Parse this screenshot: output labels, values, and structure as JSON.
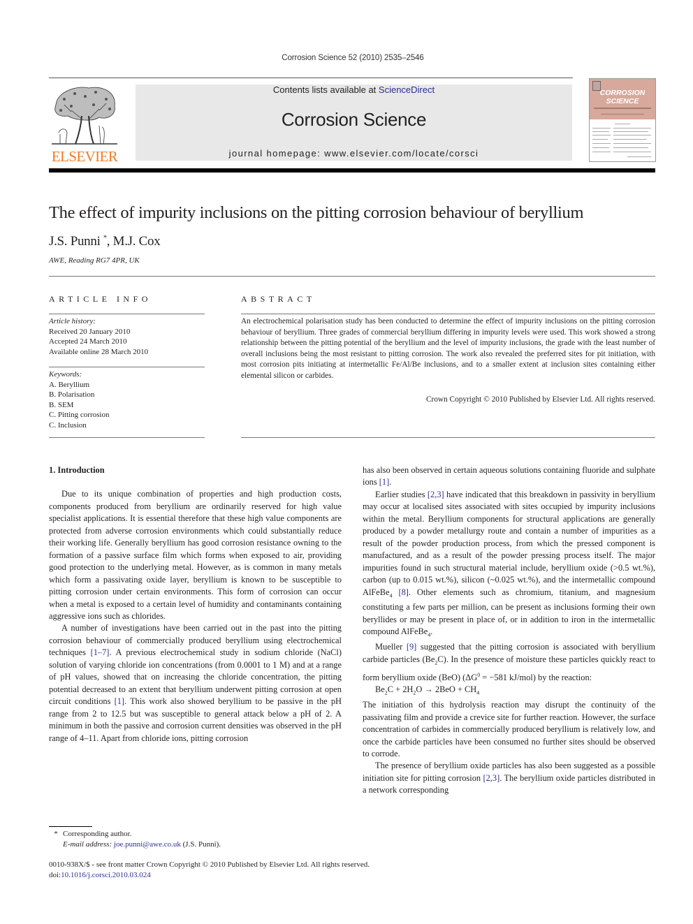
{
  "journal_ref": "Corrosion Science 52 (2010) 2535–2546",
  "masthead": {
    "contents_prefix": "Contents lists available at ",
    "contents_link": "ScienceDirect",
    "journal_name": "Corrosion Science",
    "homepage_prefix": "journal homepage: ",
    "homepage_url": "www.elsevier.com/locate/corsci",
    "publisher_logo_text": "ELSEVIER",
    "cover_title_line1": "CORROSION",
    "cover_title_line2": "SCIENCE"
  },
  "colors": {
    "elsevier_orange": "#f47a20",
    "link_blue": "#2b2f8e",
    "masthead_gray": "#e8e8e8",
    "cover_pink": "#d7a89c"
  },
  "article": {
    "title": "The effect of impurity inclusions on the pitting corrosion behaviour of beryllium",
    "authors": [
      {
        "name": "J.S. Punni",
        "mark": "*"
      },
      {
        "name": "M.J. Cox",
        "mark": ""
      }
    ],
    "author_separator": ", ",
    "affiliation": "AWE, Reading RG7 4PR, UK"
  },
  "article_info": {
    "heading": "ARTICLE INFO",
    "history_label": "Article history:",
    "history": [
      "Received 20 January 2010",
      "Accepted 24 March 2010",
      "Available online 28 March 2010"
    ],
    "keywords_label": "Keywords:",
    "keywords": [
      "A. Beryllium",
      "B. Polarisation",
      "B. SEM",
      "C. Pitting corrosion",
      "C. Inclusion"
    ]
  },
  "abstract": {
    "heading": "ABSTRACT",
    "text": "An electrochemical polarisation study has been conducted to determine the effect of impurity inclusions on the pitting corrosion behaviour of beryllium. Three grades of commercial beryllium differing in impurity levels were used. This work showed a strong relationship between the pitting potential of the beryllium and the level of impurity inclusions, the grade with the least number of overall inclusions being the most resistant to pitting corrosion. The work also revealed the preferred sites for pit initiation, with most corrosion pits initiating at intermetallic Fe/Al/Be inclusions, and to a smaller extent at inclusion sites containing either elemental silicon or carbides.",
    "copyright": "Crown Copyright © 2010 Published by Elsevier Ltd. All rights reserved."
  },
  "body": {
    "section_heading": "1. Introduction",
    "p1": "Due to its unique combination of properties and high production costs, components produced from beryllium are ordinarily reserved for high value specialist applications. It is essential therefore that these high value components are protected from adverse corrosion environments which could substantially reduce their working life. Generally beryllium has good corrosion resistance owning to the formation of a passive surface film which forms when exposed to air, providing good protection to the underlying metal. However, as is common in many metals which form a passivating oxide layer, beryllium is known to be susceptible to pitting corrosion under certain environments. This form of corrosion can occur when a metal is exposed to a certain level of humidity and contaminants containing aggressive ions such as chlorides.",
    "p2_a": "A number of investigations have been carried out in the past into the pitting corrosion behaviour of commercially produced beryllium using electrochemical techniques ",
    "p2_ref1": "[1–7]",
    "p2_b": ". A previous electrochemical study in sodium chloride (NaCl) solution of varying chloride ion concentrations (from 0.0001 to 1 M) and at a range of pH values, showed that on increasing the chloride concentration, the pitting potential decreased to an extent that beryllium underwent pitting corrosion at open circuit conditions ",
    "p2_ref2": "[1]",
    "p2_c": ". This work also showed beryllium to be passive in the pH range from 2 to 12.5 but was susceptible to general attack below a pH of 2. A minimum in both the passive and corrosion current densities was observed in the pH range of 4–11. Apart from chloride ions, pitting corrosion",
    "p3_a": "has also been observed in certain aqueous solutions containing fluoride and sulphate ions ",
    "p3_ref": "[1]",
    "p3_b": ".",
    "p4_a": "Earlier studies ",
    "p4_ref1": "[2,3]",
    "p4_b": " have indicated that this breakdown in passivity in beryllium may occur at localised sites associated with sites occupied by impurity inclusions within the metal. Beryllium components for structural applications are generally produced by a powder metallurgy route and contain a number of impurities as a result of the powder production process, from which the pressed component is manufactured, and as a result of the powder pressing process itself. The major impurities found in such structural material include, beryllium oxide (>0.5 wt.%), carbon (up to 0.015 wt.%), silicon (~0.025 wt.%), and the intermetallic compound AlFeBe",
    "p4_sub1": "4",
    "p4_ref2": "[8]",
    "p4_c": ". Other elements such as chromium, titanium, and magnesium constituting a few parts per million, can be present as inclusions forming their own beryllides or may be present in place of, or in addition to iron in the intermetallic compound AlFeBe",
    "p4_sub2": "4",
    "p4_d": ".",
    "p5_a": "Mueller ",
    "p5_ref": "[9]",
    "p5_b": " suggested that the pitting corrosion is associated with beryllium carbide particles (Be",
    "p5_sub": "2",
    "p5_c": "C). In the presence of moisture these particles quickly react to form beryllium oxide (BeO) (ΔG",
    "p5_sup": "0",
    "p5_d": " = −581 kJ/mol) by the reaction:",
    "equation": {
      "lhs1": "Be",
      "lhs1_sub": "2",
      "lhs1_rest": "C + 2H",
      "lhs2_sub": "2",
      "lhs2_rest": "O → 2BeO + CH",
      "rhs_sub": "4"
    },
    "p6": "The initiation of this hydrolysis reaction may disrupt the continuity of the passivating film and provide a crevice site for further reaction. However, the surface concentration of carbides in commercially produced beryllium is relatively low, and once the carbide particles have been consumed no further sites should be observed to corrode.",
    "p7_a": "The presence of beryllium oxide particles has also been suggested as a possible initiation site for pitting corrosion ",
    "p7_ref": "[2,3]",
    "p7_b": ". The beryllium oxide particles distributed in a network corresponding"
  },
  "footnote": {
    "star": "*",
    "corresponding": "Corresponding author.",
    "email_label": "E-mail address: ",
    "email": "joe.punni@awe.co.uk",
    "email_suffix": " (J.S. Punni)."
  },
  "front_matter": {
    "issn_line": "0010-938X/$ - see front matter Crown Copyright © 2010 Published by Elsevier Ltd. All rights reserved.",
    "doi_label": "doi:",
    "doi": "10.1016/j.corsci.2010.03.024"
  }
}
